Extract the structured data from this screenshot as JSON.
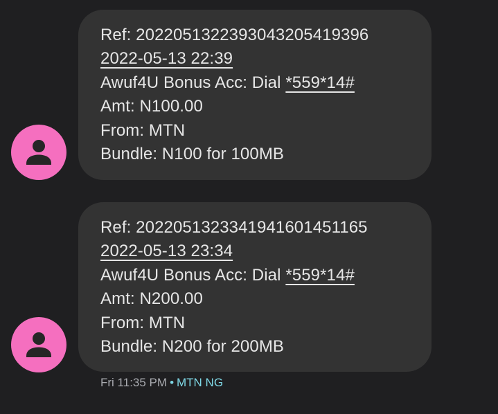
{
  "colors": {
    "background": "#1f1f21",
    "bubble": "#333333",
    "avatar": "#f56fbf",
    "text": "#e6e6e6",
    "meta_text": "#a9abb0",
    "sender": "#7fd8e6"
  },
  "messages": [
    {
      "ref": "Ref: 20220513223930432054193​96",
      "date": "2022-05-13 22:39",
      "bonus_prefix": "Awuf4U Bonus Acc: Dial ",
      "dial_code": "*559*14#",
      "amount": "Amt: N100.00",
      "from": "From: MTN",
      "bundle": "Bundle: N100 for 100MB",
      "avatar_icon": "person-icon"
    },
    {
      "ref": "Ref: 202205132334194160145116​5",
      "date": "2022-05-13 23:34",
      "bonus_prefix": "Awuf4U Bonus Acc: Dial ",
      "dial_code": "*559*14#",
      "amount": "Amt: N200.00",
      "from": "From: MTN",
      "bundle": "Bundle: N200 for 200MB",
      "avatar_icon": "person-icon"
    }
  ],
  "footer": {
    "time": "Fri 11:35 PM",
    "separator": "•",
    "sender": "MTN NG"
  }
}
